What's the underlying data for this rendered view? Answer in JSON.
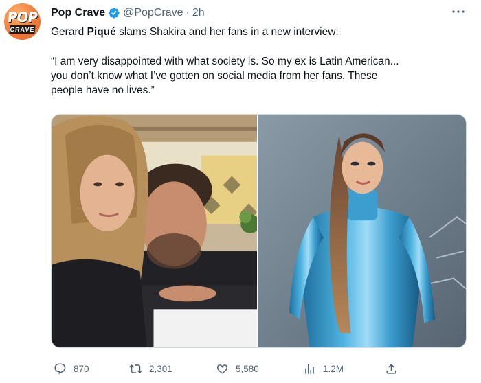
{
  "author": {
    "name": "Pop Crave",
    "handle": "@PopCrave",
    "separator": "·",
    "time": "2h",
    "avatar_logo": {
      "top": "POP",
      "bottom": "CRAVE"
    },
    "verified_icon": "verified-badge-icon",
    "verified_color": "#1d9bf0"
  },
  "tweet": {
    "line1_prefix": "Gerard ",
    "line1_bold": "Piqué",
    "line1_suffix": " slams Shakira and her fans in a new interview:",
    "quote_lines": [
      "“I am very disappointed with what society is. So my ex is Latin American...",
      "you don’t know what I’ve gotten on social media from her fans. These",
      "people have no lives.”"
    ]
  },
  "media": {
    "left_photo": "couple-selfie-image",
    "right_photo": "shakira-blue-latex-image"
  },
  "stats": {
    "replies": "870",
    "retweets": "2,301",
    "likes": "5,580",
    "views": "1.2M"
  },
  "icons": {
    "more": "more-options-icon",
    "reply": "reply-icon",
    "retweet": "retweet-icon",
    "like": "heart-icon",
    "views": "views-chart-icon",
    "share": "share-icon"
  },
  "colors": {
    "text": "#0f1419",
    "muted": "#536471",
    "border": "#cfd9de",
    "brand_avatar": "#f07a3a"
  }
}
